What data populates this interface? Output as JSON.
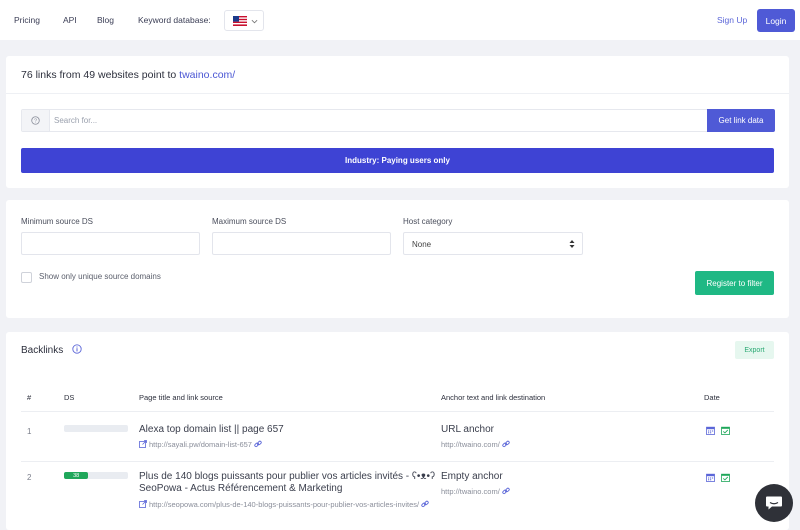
{
  "nav": {
    "pricing": "Pricing",
    "api": "API",
    "blog": "Blog",
    "keyword_db_label": "Keyword database:",
    "signup": "Sign Up",
    "login": "Login"
  },
  "summary": {
    "prefix": "76 links from 49 websites point to ",
    "domain": "twaino.com/"
  },
  "search": {
    "placeholder": "Search for...",
    "button": "Get link data"
  },
  "industry_button": "Industry: Paying users only",
  "filters": {
    "min_ds_label": "Minimum source DS",
    "max_ds_label": "Maximum source DS",
    "host_category_label": "Host category",
    "host_category_value": "None",
    "unique_domains_label": "Show only unique source domains",
    "register_button": "Register to filter"
  },
  "backlinks": {
    "title": "Backlinks",
    "export": "Export",
    "columns": [
      "#",
      "DS",
      "Page title and link source",
      "Anchor text and link destination",
      "Date"
    ],
    "rows": [
      {
        "num": "1",
        "ds": "",
        "ds_fraction": 0,
        "title": "Alexa top domain list || page 657",
        "source": "http://sayali.pw/domain-list-657",
        "anchor": "URL anchor",
        "destination": "http://twaino.com/"
      },
      {
        "num": "2",
        "ds": "38",
        "ds_fraction": 0.38,
        "title": "Plus de 140 blogs puissants pour publier vos articles invités - ʕ•ᴥ•ʔ SeoPowa - Actus Référencement & Marketing",
        "source": "http://seopowa.com/plus-de-140-blogs-puissants-pour-publier-vos-articles-invites/",
        "anchor": "Empty anchor",
        "destination": "http://twaino.com/"
      }
    ]
  },
  "colors": {
    "primary": "#4f5ad6",
    "industry": "#3e43d4",
    "green": "#1fb884",
    "ds_green": "#1fa75a"
  }
}
